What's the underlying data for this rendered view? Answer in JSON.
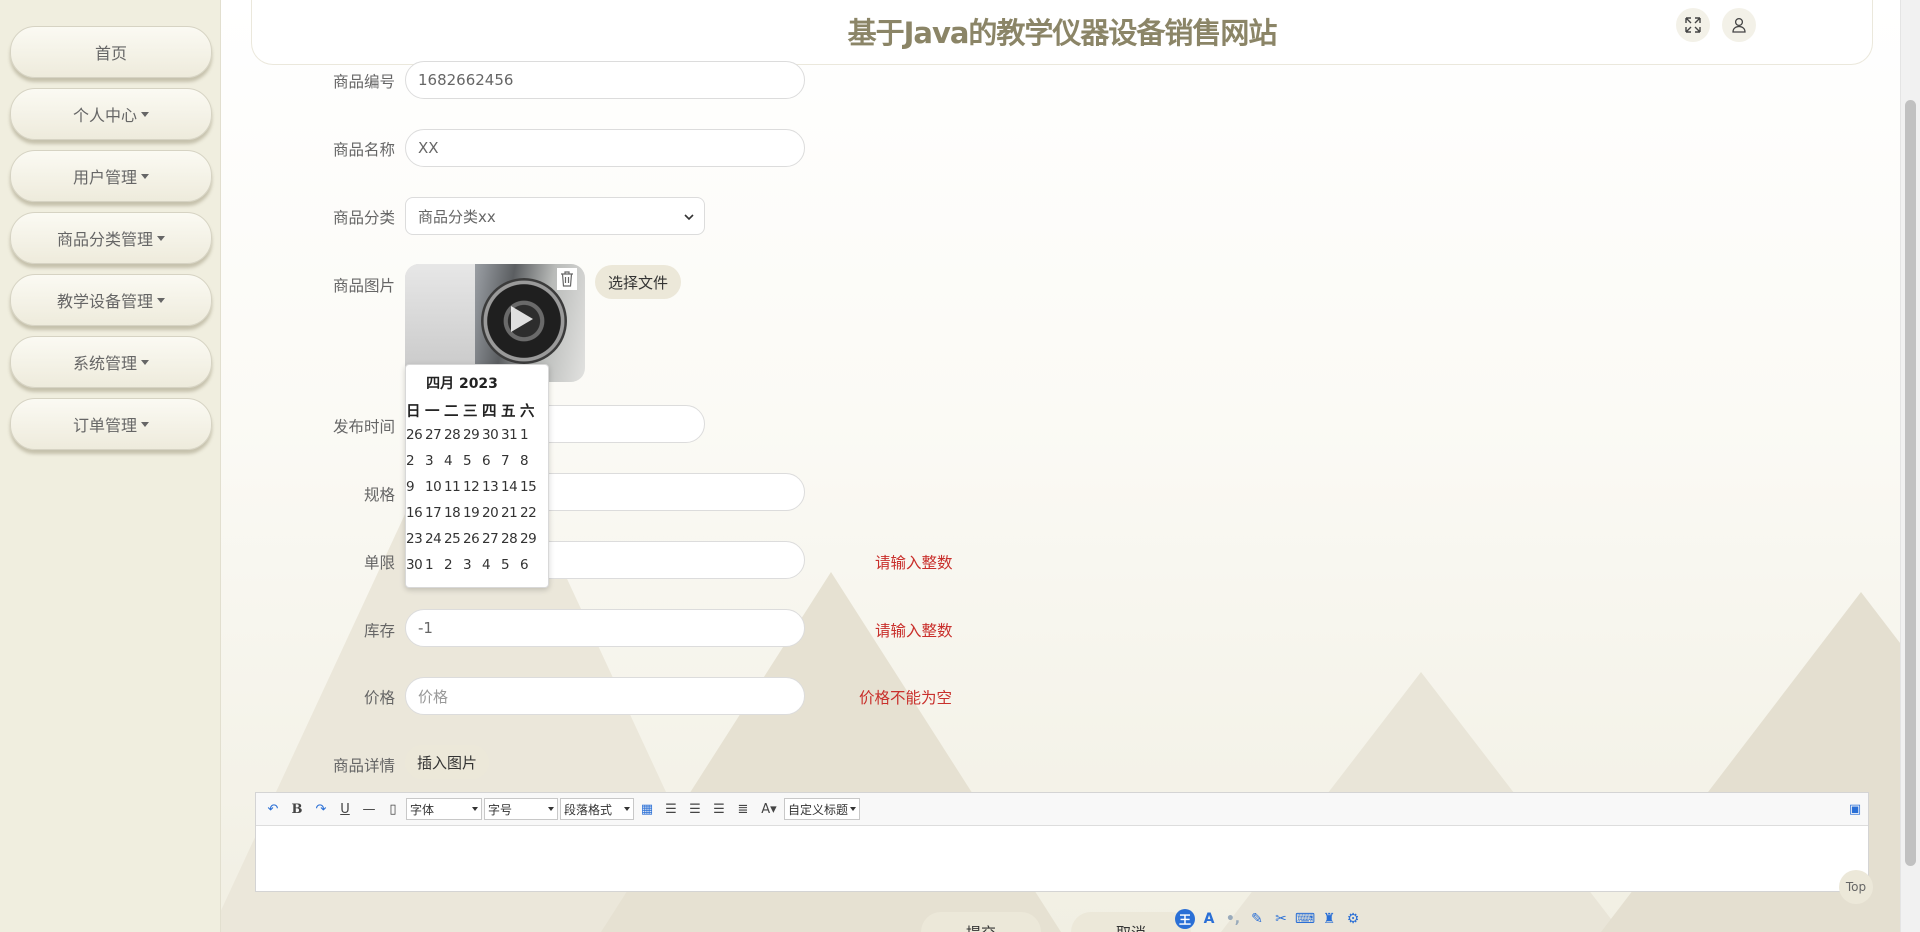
{
  "app": {
    "title": "基于Java的教学仪器设备销售网站"
  },
  "sidebar": {
    "items": [
      {
        "label": "首页",
        "dropdown": false
      },
      {
        "label": "个人中心",
        "dropdown": true
      },
      {
        "label": "用户管理",
        "dropdown": true
      },
      {
        "label": "商品分类管理",
        "dropdown": true
      },
      {
        "label": "教学设备管理",
        "dropdown": true
      },
      {
        "label": "系统管理",
        "dropdown": true
      },
      {
        "label": "订单管理",
        "dropdown": true
      }
    ]
  },
  "header": {
    "fullscreen_icon": "expand-icon",
    "user_icon": "user-icon"
  },
  "form": {
    "code": {
      "label": "商品编号",
      "value": "1682662456"
    },
    "name": {
      "label": "商品名称",
      "value": "XX"
    },
    "category": {
      "label": "商品分类",
      "value": "商品分类xx"
    },
    "image": {
      "label": "商品图片",
      "choose_file": "选择文件",
      "delete_icon": "trash-icon"
    },
    "publish_time": {
      "label": "发布时间"
    },
    "spec": {
      "label": "规格"
    },
    "limit": {
      "label": "单限",
      "error": "请输入整数"
    },
    "stock": {
      "label": "库存",
      "value": "-1",
      "error": "请输入整数"
    },
    "price": {
      "label": "价格",
      "placeholder": "价格",
      "error": "价格不能为空"
    },
    "detail": {
      "label": "商品详情",
      "insert_image": "插入图片"
    }
  },
  "calendar": {
    "title": "四月 2023",
    "weekdays": [
      "日",
      "一",
      "二",
      "三",
      "四",
      "五",
      "六"
    ],
    "weeks": [
      [
        "26",
        "27",
        "28",
        "29",
        "30",
        "31",
        "1"
      ],
      [
        "2",
        "3",
        "4",
        "5",
        "6",
        "7",
        "8"
      ],
      [
        "9",
        "10",
        "11",
        "12",
        "13",
        "14",
        "15"
      ],
      [
        "16",
        "17",
        "18",
        "19",
        "20",
        "21",
        "22"
      ],
      [
        "23",
        "24",
        "25",
        "26",
        "27",
        "28",
        "29"
      ],
      [
        "30",
        "1",
        "2",
        "3",
        "4",
        "5",
        "6"
      ]
    ]
  },
  "editor": {
    "font_select": "字体",
    "size_select": "字号",
    "paragraph_select": "段落格式",
    "custom_title_select": "自定义标题"
  },
  "actions": {
    "submit": "提交",
    "cancel": "取消"
  },
  "floating": {
    "top_label": "Top"
  },
  "colors": {
    "accent": "#ece8d9",
    "title": "#8b8567",
    "error": "#c9302c",
    "sidebar": "#f0eedf"
  }
}
